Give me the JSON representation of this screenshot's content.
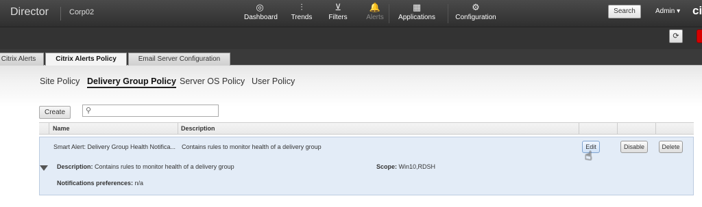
{
  "header": {
    "brand": "Director",
    "site": "Corp02",
    "nav": [
      {
        "label": "Dashboard",
        "icon": "dashboard-icon",
        "glyph": "◎"
      },
      {
        "label": "Trends",
        "icon": "trends-icon",
        "glyph": "⫶"
      },
      {
        "label": "Filters",
        "icon": "filters-icon",
        "glyph": "⊻"
      },
      {
        "label": "Alerts",
        "icon": "alerts-icon",
        "glyph": "🔔"
      },
      {
        "label": "Applications",
        "icon": "applications-icon",
        "glyph": "▦"
      },
      {
        "label": "Configuration",
        "icon": "gear-icon",
        "glyph": "⚙"
      }
    ],
    "search_label": "Search",
    "user_label": "Admin ▾",
    "logo_text": "ci"
  },
  "subbar": {
    "refresh_glyph": "⟳"
  },
  "tabs": [
    {
      "label": "Citrix Alerts"
    },
    {
      "label": "Citrix Alerts Policy"
    },
    {
      "label": "Email Server Configuration"
    }
  ],
  "subtabs": [
    {
      "label": "Site Policy"
    },
    {
      "label": "Delivery Group Policy"
    },
    {
      "label": "Server OS Policy"
    },
    {
      "label": "User Policy"
    }
  ],
  "toolbar": {
    "create_label": "Create",
    "search_placeholder": ""
  },
  "table": {
    "columns": [
      "Name",
      "Description"
    ],
    "rows": [
      {
        "name": "Smart Alert: Delivery Group Health Notifica...",
        "description": "Contains rules to monitor health of a delivery group",
        "edit_label": "Edit",
        "disable_label": "Disable",
        "delete_label": "Delete",
        "details": {
          "description_label": "Description:",
          "description_value": "Contains rules to monitor health of a delivery group",
          "scope_label": "Scope:",
          "scope_value": "Win10,RDSH",
          "notifications_label": "Notifications preferences:",
          "notifications_value": "n/a"
        }
      }
    ]
  }
}
